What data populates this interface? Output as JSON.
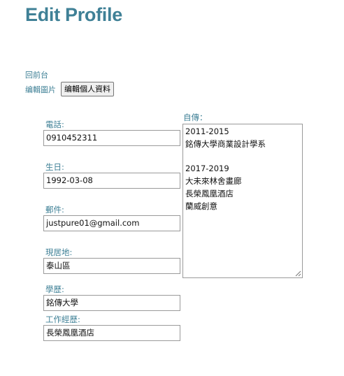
{
  "page": {
    "title": "Edit Profile"
  },
  "links": {
    "back": "回前台",
    "edit_picture": "编輯圖片"
  },
  "buttons": {
    "edit_profile": "编輯個人資料"
  },
  "fields": {
    "phone": {
      "label": "電話:",
      "value": "0910452311"
    },
    "birthday": {
      "label": "生日:",
      "value": "1992-03-08"
    },
    "email": {
      "label": "郵件:",
      "value": "justpure01@gmail.com"
    },
    "location": {
      "label": "現居地:",
      "value": "泰山區"
    },
    "education": {
      "label": "學歷:",
      "value": "銘傳大學"
    },
    "experience": {
      "label": "工作經歷:",
      "value": "長榮鳳凰酒店"
    }
  },
  "bio": {
    "label": "自傳：",
    "lines": [
      "2011-2015",
      "銘傳大學商業設計學系",
      "",
      "2017-2019",
      "大未來林舍畫廊",
      "長榮鳳凰酒店",
      "蘭威創意"
    ]
  }
}
